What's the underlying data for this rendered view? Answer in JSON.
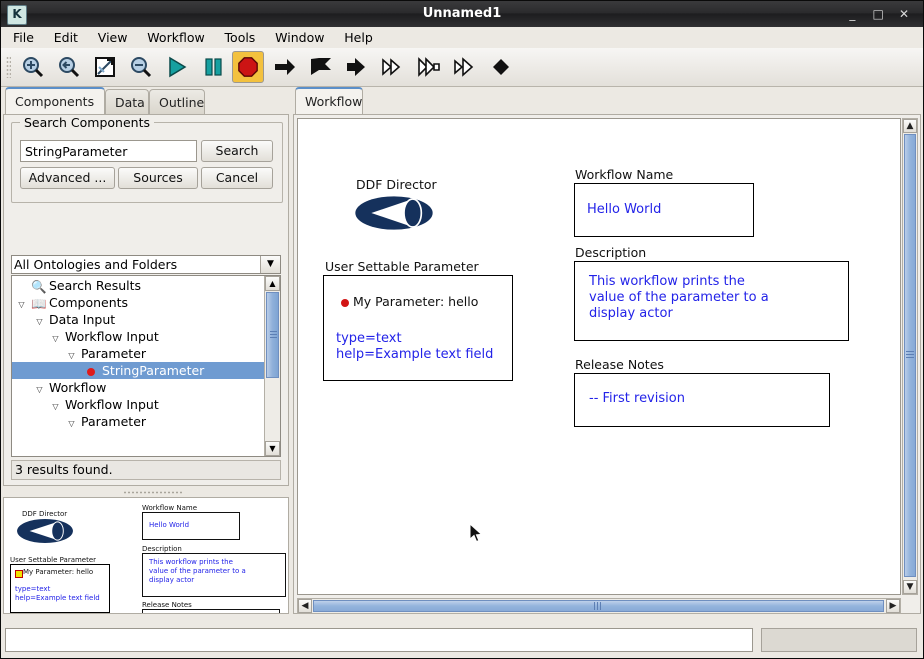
{
  "window": {
    "title": "Unnamed1",
    "app_icon_letter": "K",
    "controls": {
      "minimize": "_",
      "maximize": "□",
      "close": "✕"
    }
  },
  "menubar": {
    "items": [
      "File",
      "Edit",
      "View",
      "Workflow",
      "Tools",
      "Window",
      "Help"
    ]
  },
  "toolbar": {
    "buttons": [
      {
        "name": "zoom-in-icon",
        "tip": "Zoom In"
      },
      {
        "name": "zoom-reset-icon",
        "tip": "Zoom Reset"
      },
      {
        "name": "zoom-fit-icon",
        "tip": "Zoom Fit"
      },
      {
        "name": "zoom-out-icon",
        "tip": "Zoom Out"
      },
      {
        "name": "run-icon",
        "tip": "Run"
      },
      {
        "name": "pause-icon",
        "tip": "Pause"
      },
      {
        "name": "stop-icon",
        "tip": "Stop"
      },
      {
        "name": "step-arrow-icon",
        "tip": "Step"
      },
      {
        "name": "flag-arrow-icon",
        "tip": "Run to Breakpoint"
      },
      {
        "name": "solid-arrow-icon",
        "tip": "Step Into"
      },
      {
        "name": "double-arrow-icon",
        "tip": "Step Over"
      },
      {
        "name": "double-outline-arrow-icon",
        "tip": "Step Out"
      },
      {
        "name": "double-chevron-arrow-icon",
        "tip": "Continue"
      },
      {
        "name": "diamond-icon",
        "tip": "Breakpoint"
      }
    ]
  },
  "left_panel": {
    "tabs": [
      {
        "label": "Components",
        "active": true
      },
      {
        "label": "Data",
        "active": false
      },
      {
        "label": "Outline",
        "active": false
      }
    ],
    "search_group": {
      "title": "Search Components",
      "query_value": "StringParameter",
      "query_placeholder": "",
      "search_button": "Search",
      "advanced_button": "Advanced ...",
      "sources_button": "Sources",
      "cancel_button": "Cancel"
    },
    "scope_combo": {
      "selected": "All Ontologies and Folders"
    },
    "tree": [
      {
        "indent": 0,
        "twisty": "",
        "icon": "search-icon",
        "label": "Search Results",
        "selected": false
      },
      {
        "indent": 0,
        "twisty": "▽",
        "icon": "book-icon",
        "label": "Components",
        "selected": false
      },
      {
        "indent": 1,
        "twisty": "▽",
        "icon": "",
        "label": "Data Input",
        "selected": false
      },
      {
        "indent": 2,
        "twisty": "▽",
        "icon": "",
        "label": "Workflow Input",
        "selected": false
      },
      {
        "indent": 3,
        "twisty": "▽",
        "icon": "",
        "label": "Parameter",
        "selected": false
      },
      {
        "indent": 4,
        "twisty": "",
        "icon": "red-dot-icon",
        "label": "StringParameter",
        "selected": true
      },
      {
        "indent": 1,
        "twisty": "▽",
        "icon": "",
        "label": "Workflow",
        "selected": false
      },
      {
        "indent": 2,
        "twisty": "▽",
        "icon": "",
        "label": "Workflow Input",
        "selected": false
      },
      {
        "indent": 3,
        "twisty": "▽",
        "icon": "",
        "label": "Parameter",
        "selected": false
      }
    ],
    "results_status": "3 results found."
  },
  "main_panel": {
    "tabs": [
      {
        "label": "Workflow",
        "active": true
      }
    ]
  },
  "canvas": {
    "director": {
      "label": "DDF Director",
      "color": "#15315c"
    },
    "parameter_actor": {
      "label": "User Settable Parameter",
      "name": "My Parameter: hello",
      "body": "type=text\nhelp=Example text field",
      "dot_color": "#d21414"
    },
    "annotations": [
      {
        "label": "Workflow Name",
        "text": "Hello World"
      },
      {
        "label": "Description",
        "text": "This workflow prints the\nvalue of the parameter to a\ndisplay actor"
      },
      {
        "label": "Release Notes",
        "text": "-- First revision"
      }
    ],
    "text_color": "#2323e8"
  },
  "status_bar": {
    "message": "",
    "progress_label": ""
  },
  "colors": {
    "selection_blue": "#6f9bd1",
    "annotation_blue": "#2323e8",
    "director_navy": "#15315c",
    "stop_red": "#cc1414",
    "run_teal": "#139a9a",
    "accent_tab": "#5b8fc9"
  }
}
